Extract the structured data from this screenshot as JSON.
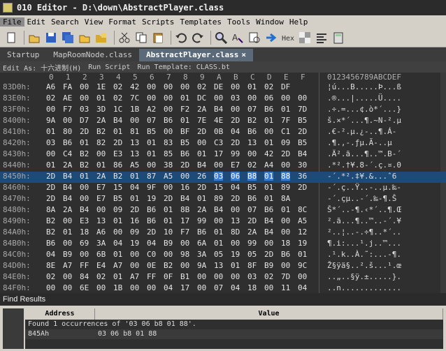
{
  "window": {
    "title": "010 Editor - D:\\down\\AbstractPlayer.class"
  },
  "menu": [
    {
      "label": "File",
      "active": true
    },
    {
      "label": "Edit"
    },
    {
      "label": "Search"
    },
    {
      "label": "View"
    },
    {
      "label": "Format"
    },
    {
      "label": "Scripts"
    },
    {
      "label": "Templates"
    },
    {
      "label": "Tools"
    },
    {
      "label": "Window"
    },
    {
      "label": "Help"
    }
  ],
  "toolbar": [
    "new-file-icon",
    "open-icon",
    "save-icon",
    "save-all-icon",
    "open-folder-icon",
    "multi-folder-icon",
    "cut-icon",
    "copy-icon",
    "paste-icon",
    "undo-icon",
    "redo-icon",
    "find-icon",
    "replace-icon",
    "find-in-files-icon",
    "goto-icon",
    "hex-icon",
    "mask-icon",
    "compare-icon",
    "calc-icon"
  ],
  "tabs": [
    {
      "label": "Startup"
    },
    {
      "label": "MapRoomNode.class"
    },
    {
      "label": "AbstractPlayer.class",
      "active": true,
      "close": "×"
    }
  ],
  "options": {
    "edit_as": "Edit As: 十六进制(H)",
    "run_script": "Run Script",
    "run_template": "Run Template: CLASS.bt"
  },
  "hex": {
    "columns": [
      "0",
      "1",
      "2",
      "3",
      "4",
      "5",
      "6",
      "7",
      "8",
      "9",
      "A",
      "B",
      "C",
      "D",
      "E",
      "F"
    ],
    "ascii_header": "0123456789ABCDEF",
    "rows": [
      {
        "addr": "83D0h:",
        "bytes": [
          "A6",
          "FA",
          "00",
          "1E",
          "02",
          "42",
          "00",
          "00",
          "00",
          "02",
          "DE",
          "00",
          "01",
          "02",
          "DF",
          ""
        ],
        "ascii": "¦ú...B.....Þ...ß"
      },
      {
        "addr": "83E0h:",
        "bytes": [
          "02",
          "AE",
          "00",
          "01",
          "02",
          "7C",
          "00",
          "00",
          "01",
          "DC",
          "00",
          "03",
          "00",
          "06",
          "00",
          "00"
        ],
        "ascii": ".®...|.....Ü...."
      },
      {
        "addr": "83F0h:",
        "bytes": [
          "00",
          "F7",
          "03",
          "3D",
          "1C",
          "1B",
          "A2",
          "00",
          "F2",
          "2A",
          "B4",
          "00",
          "07",
          "B6",
          "01",
          "7D"
        ],
        "ascii": ".÷.=...¢.ò*´...}"
      },
      {
        "addr": "8400h:",
        "bytes": [
          "9A",
          "00",
          "D7",
          "2A",
          "B4",
          "00",
          "07",
          "B6",
          "01",
          "7E",
          "4E",
          "2D",
          "B2",
          "01",
          "7F",
          "B5"
        ],
        "ascii": "š.×*´...¶.~N-².µ"
      },
      {
        "addr": "8410h:",
        "bytes": [
          "01",
          "80",
          "2D",
          "B2",
          "01",
          "81",
          "B5",
          "00",
          "BF",
          "2D",
          "0B",
          "04",
          "B6",
          "00",
          "C1",
          "2D"
        ],
        "ascii": ".€-².µ.¿-..¶.Á-"
      },
      {
        "addr": "8420h:",
        "bytes": [
          "03",
          "B6",
          "01",
          "82",
          "2D",
          "13",
          "01",
          "83",
          "B5",
          "00",
          "C3",
          "2D",
          "13",
          "01",
          "09",
          "B5"
        ],
        "ascii": ".¶.‚-.ƒµ.Ã-..µ"
      },
      {
        "addr": "8430h:",
        "bytes": [
          "00",
          "C4",
          "B2",
          "00",
          "E3",
          "13",
          "01",
          "85",
          "B6",
          "01",
          "17",
          "99",
          "00",
          "42",
          "2D",
          "B4"
        ],
        "ascii": ".Ä².ã...¶..™.B-´"
      },
      {
        "addr": "8440h:",
        "bytes": [
          "01",
          "2A",
          "B2",
          "01",
          "86",
          "A5",
          "00",
          "38",
          "2D",
          "B4",
          "00",
          "E7",
          "02",
          "A4",
          "00",
          "30"
        ],
        "ascii": ".*².†¥.8-´.ç.¤.0"
      },
      {
        "addr": "8450h:",
        "bytes": [
          "2D",
          "B4",
          "01",
          "2A",
          "B2",
          "01",
          "87",
          "A5",
          "00",
          "26",
          "03",
          "06",
          "B8",
          "01",
          "88",
          "36"
        ],
        "ascii": "-´.*².‡¥.&...ˆ6",
        "highlight": true,
        "sel_start": 10,
        "sel_end": 14
      },
      {
        "addr": "8460h:",
        "bytes": [
          "2D",
          "B4",
          "00",
          "E7",
          "15",
          "04",
          "9F",
          "00",
          "16",
          "2D",
          "15",
          "04",
          "B5",
          "01",
          "89",
          "2D"
        ],
        "ascii": "-´.ç..Ÿ..-..µ.‰-"
      },
      {
        "addr": "8470h:",
        "bytes": [
          "2D",
          "B4",
          "00",
          "E7",
          "B5",
          "01",
          "19",
          "2D",
          "B4",
          "01",
          "89",
          "2D",
          "B6",
          "01",
          "8A",
          ""
        ],
        "ascii": "-´.çµ..-´.‰-¶.Š"
      },
      {
        "addr": "8480h:",
        "bytes": [
          "8A",
          "2A",
          "B4",
          "00",
          "09",
          "2D",
          "B6",
          "01",
          "8B",
          "2A",
          "B4",
          "00",
          "07",
          "B6",
          "01",
          "8C"
        ],
        "ascii": "Š*´..-¶.‹*´..¶.Œ"
      },
      {
        "addr": "8490h:",
        "bytes": [
          "B2",
          "00",
          "E3",
          "13",
          "01",
          "16",
          "B6",
          "01",
          "17",
          "99",
          "00",
          "13",
          "2D",
          "B4",
          "00",
          "A5"
        ],
        "ascii": "².ã...¶..™..-´.¥"
      },
      {
        "addr": "84A0h:",
        "bytes": [
          "B2",
          "01",
          "18",
          "A6",
          "00",
          "09",
          "2D",
          "10",
          "F7",
          "B6",
          "01",
          "8D",
          "2A",
          "B4",
          "00",
          "12"
        ],
        "ascii": "²..¦..-.÷¶..*´.."
      },
      {
        "addr": "84B0h:",
        "bytes": [
          "B6",
          "00",
          "69",
          "3A",
          "04",
          "19",
          "04",
          "B9",
          "00",
          "6A",
          "01",
          "00",
          "99",
          "00",
          "18",
          "19"
        ],
        "ascii": "¶.i:...¹.j..™..."
      },
      {
        "addr": "84C0h:",
        "bytes": [
          "04",
          "B9",
          "00",
          "6B",
          "01",
          "00",
          "C0",
          "00",
          "98",
          "3A",
          "05",
          "19",
          "05",
          "2D",
          "B6",
          "01"
        ],
        "ascii": ".¹.k..À.˜:...-¶."
      },
      {
        "addr": "84D0h:",
        "bytes": [
          "8E",
          "A7",
          "FF",
          "E4",
          "A7",
          "00",
          "0E",
          "B2",
          "00",
          "9A",
          "13",
          "01",
          "8F",
          "B9",
          "00",
          "9C"
        ],
        "ascii": "Ž§ÿä§..².š...¹.œ"
      },
      {
        "addr": "84E0h:",
        "bytes": [
          "02",
          "00",
          "84",
          "02",
          "01",
          "A7",
          "FF",
          "0F",
          "B1",
          "00",
          "00",
          "00",
          "03",
          "02",
          "7D",
          "00"
        ],
        "ascii": "..„..§ÿ.±.....}."
      },
      {
        "addr": "84F0h:",
        "bytes": [
          "00",
          "00",
          "6E",
          "00",
          "1B",
          "00",
          "00",
          "04",
          "17",
          "00",
          "07",
          "04",
          "18",
          "00",
          "11",
          "04"
        ],
        "ascii": "..n............."
      }
    ]
  },
  "find": {
    "panel_title": "Find Results",
    "col_address": "Address",
    "col_value": "Value",
    "summary": "Found 1 occurrences of '03 06 b8 01 88'.",
    "results": [
      {
        "address": "845Ah",
        "value": "03 06 b8 01 88"
      }
    ]
  }
}
